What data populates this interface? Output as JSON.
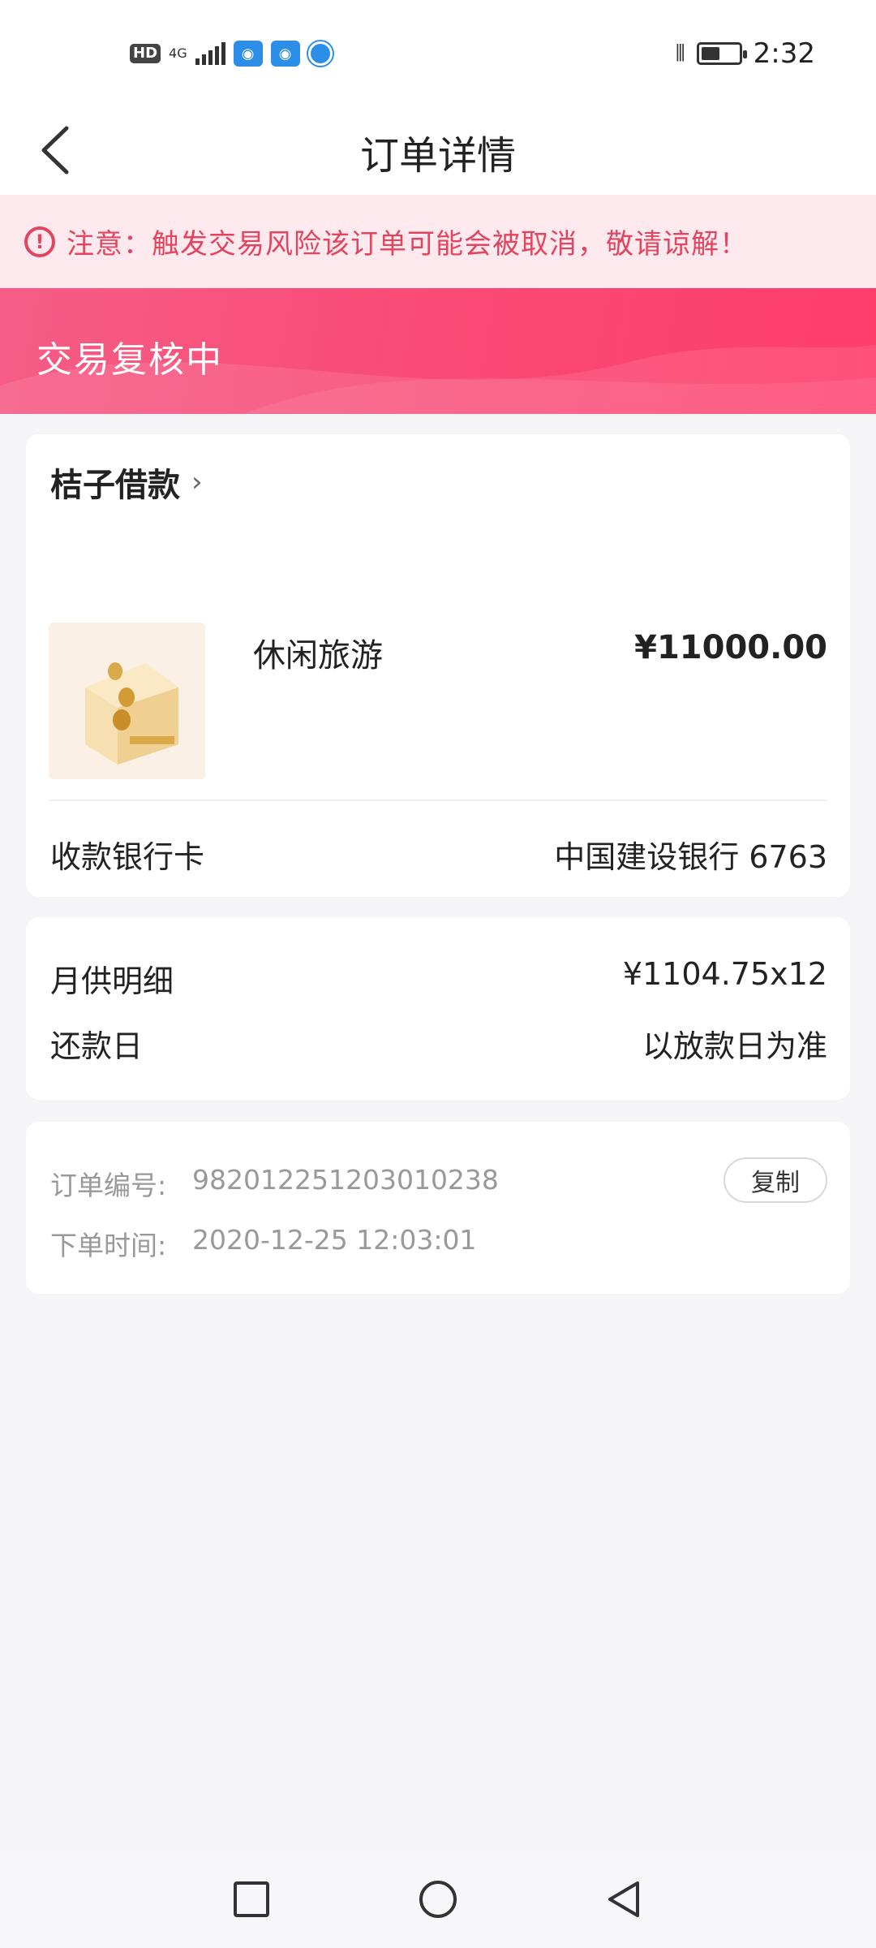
{
  "status_bar": {
    "hd_badge": "HD",
    "network": "4G",
    "time": "2:32",
    "battery_level": 0.5
  },
  "nav": {
    "title": "订单详情"
  },
  "notice": {
    "icon": "!",
    "text": "注意：触发交易风险该订单可能会被取消，敬请谅解！"
  },
  "banner": {
    "status": "交易复核中"
  },
  "order": {
    "merchant": "桔子借款",
    "product_name": "休闲旅游",
    "price": "¥11000.00",
    "bank_label": "收款银行卡",
    "bank_value": "中国建设银行 6763"
  },
  "repayment": {
    "monthly_label": "月供明细",
    "monthly_value": "¥1104.75x12",
    "due_label": "还款日",
    "due_value": "以放款日为准"
  },
  "meta": {
    "order_no_label": "订单编号:",
    "order_no": "982012251203010238",
    "copy_label": "复制",
    "time_label": "下单时间:",
    "time_value": "2020-12-25 12:03:01"
  },
  "icons": {
    "back": "back-arrow-icon",
    "chevron": "chevron-right-icon",
    "warning": "warning-icon",
    "home": "circle-home-icon",
    "recents": "square-recents-icon",
    "sys_back": "triangle-back-icon"
  },
  "colors": {
    "accent": "#f94a75",
    "notice_text": "#e2455f",
    "notice_bg": "#fde9ee",
    "page_bg": "#f5f5f7"
  }
}
